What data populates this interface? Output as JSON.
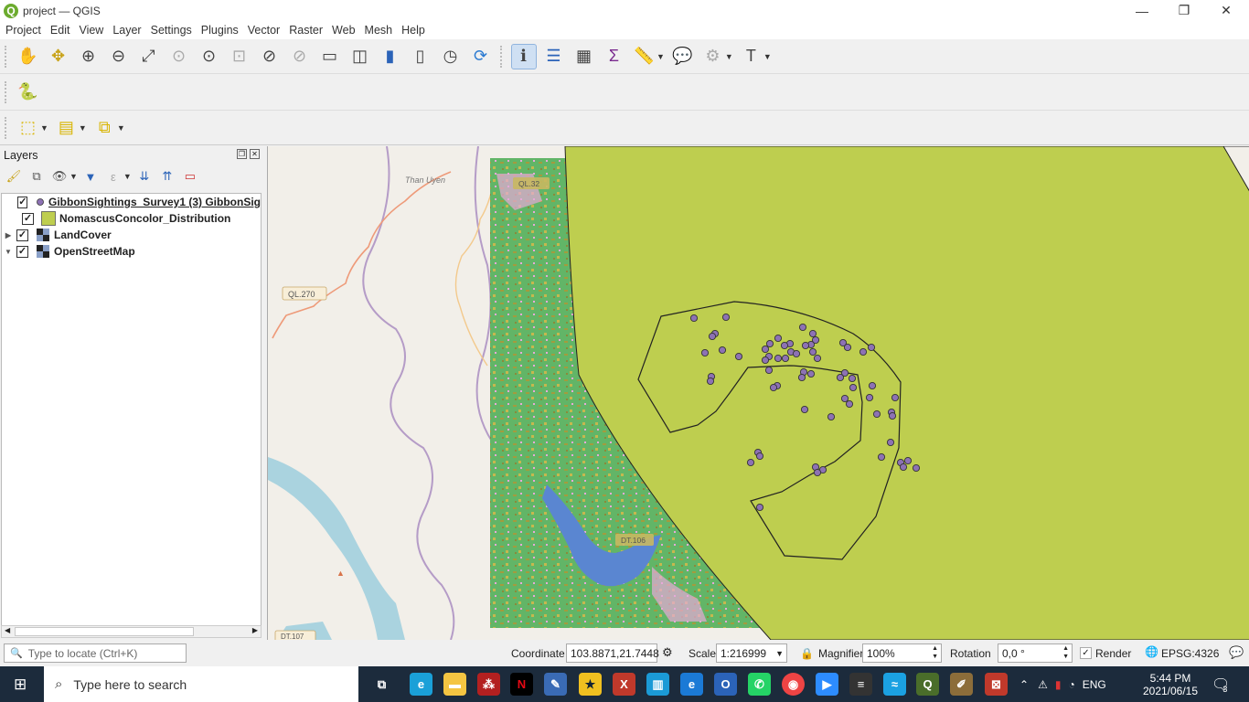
{
  "window": {
    "title": "project — QGIS",
    "minimize": "—",
    "restore": "❐",
    "close": "✕"
  },
  "menu": [
    "Project",
    "Edit",
    "View",
    "Layer",
    "Settings",
    "Plugins",
    "Vector",
    "Raster",
    "Web",
    "Mesh",
    "Help"
  ],
  "layers_panel": {
    "title": "Layers",
    "layers": [
      {
        "name": "GibbonSightings_Survey1 (3) GibbonSig",
        "checked": true,
        "symbol": "point",
        "expandable": false
      },
      {
        "name": "NomascusConcolor_Distribution",
        "checked": true,
        "symbol": "polygon-fill",
        "expandable": false
      },
      {
        "name": "LandCover",
        "checked": true,
        "symbol": "raster",
        "expandable": true,
        "expanded": false
      },
      {
        "name": "OpenStreetMap",
        "checked": true,
        "symbol": "raster",
        "expandable": true,
        "expanded": true
      }
    ]
  },
  "map_labels": {
    "town": "Than Uyen",
    "road1": "QL.32",
    "road2": "QL.270",
    "road3": "DT.106",
    "road4": "DT.107"
  },
  "status": {
    "locate_placeholder": "Type to locate (Ctrl+K)",
    "coordinate_label": "Coordinate",
    "coordinate_value": "103.8871,21.7448",
    "scale_label": "Scale",
    "scale_value": "1:216999",
    "magnifier_label": "Magnifier",
    "magnifier_value": "100%",
    "rotation_label": "Rotation",
    "rotation_value": "0,0 °",
    "render_label": "Render",
    "render_checked": true,
    "crs": "EPSG:4326"
  },
  "taskbar": {
    "search_placeholder": "Type here to search",
    "time": "5:44 PM",
    "date": "2021/06/15",
    "language": "ENG",
    "notifications": "3"
  },
  "colors": {
    "distribution_fill": "#bece4f",
    "sighting_point": "#8d72b4",
    "landcover_green": "#62b567",
    "water": "#5a86d1",
    "osm_bg": "#f2efe9"
  }
}
